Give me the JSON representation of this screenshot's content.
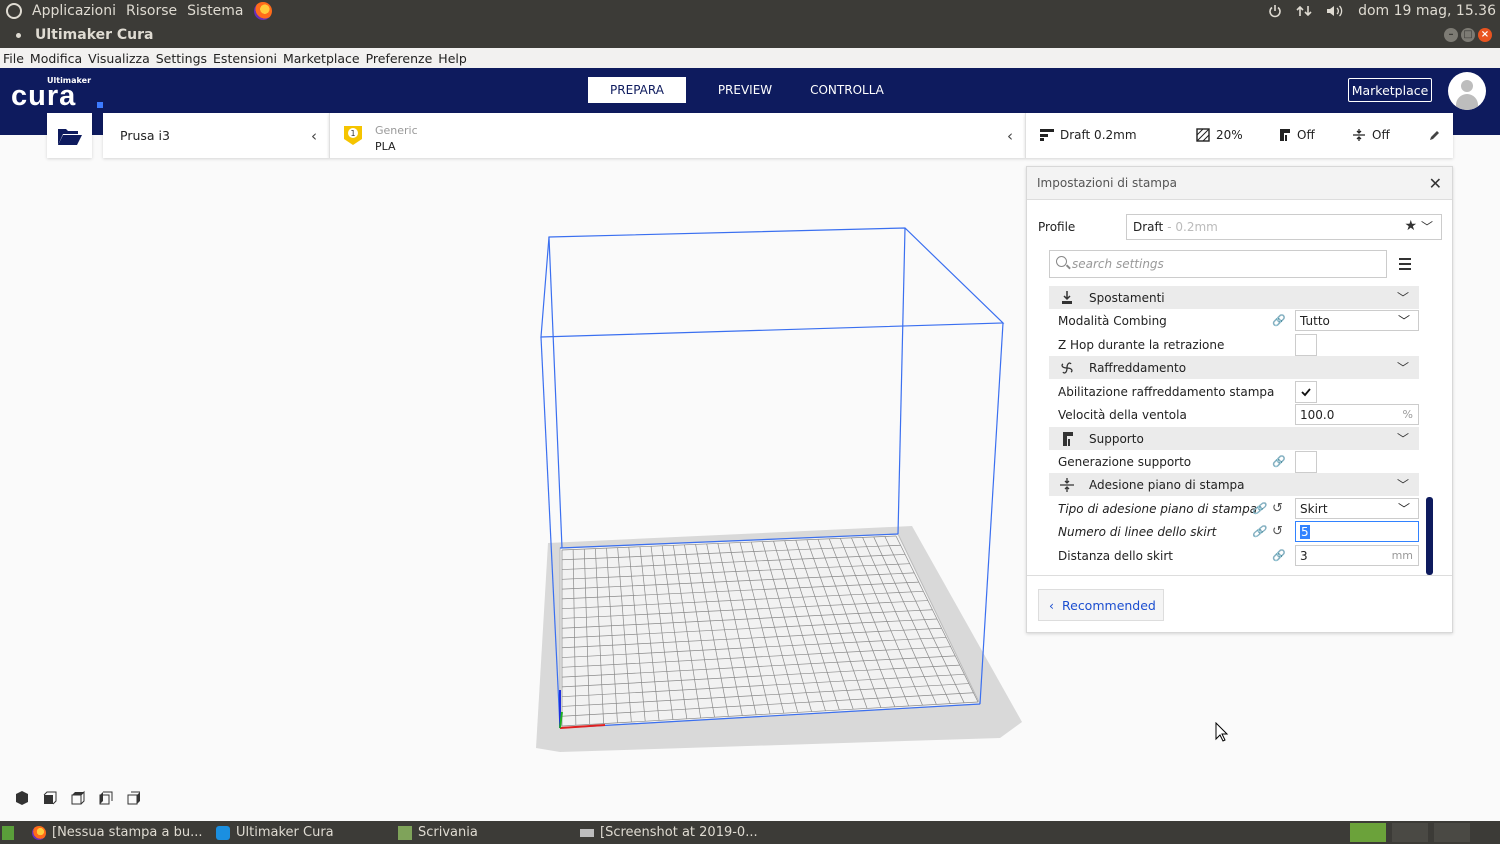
{
  "os_panel": {
    "applications": "Applicazioni",
    "places": "Risorse",
    "system": "Sistema",
    "datetime": "dom 19 mag, 15.36"
  },
  "window": {
    "title": "Ultimaker Cura"
  },
  "menu": [
    "File",
    "Modifica",
    "Visualizza",
    "Settings",
    "Estensioni",
    "Marketplace",
    "Preferenze",
    "Help"
  ],
  "header": {
    "logo_small": "Ultimaker",
    "logo_big": "cura",
    "tabs": [
      "PREPARA",
      "PREVIEW",
      "CONTROLLA"
    ],
    "marketplace": "Marketplace"
  },
  "toolbar": {
    "printer": "Prusa i3",
    "material_brand": "Generic",
    "material_name": "PLA",
    "material_badge": "1",
    "profile": "Draft 0.2mm",
    "infill": "20%",
    "support": "Off",
    "adhesion": "Off"
  },
  "settings": {
    "title": "Impostazioni di stampa",
    "profile_label": "Profile",
    "profile_name": "Draft",
    "profile_layer": " - 0.2mm",
    "search_placeholder": "search settings",
    "rows": {
      "travel": "Spostamenti",
      "combing": "Modalità Combing",
      "combing_value": "Tutto",
      "zhop": "Z Hop durante la retrazione",
      "cooling": "Raffreddamento",
      "enable_cooling": "Abilitazione raffreddamento stampa",
      "fan_speed": "Velocità della ventola",
      "fan_speed_value": "100.0",
      "fan_speed_unit": "%",
      "support": "Supporto",
      "gen_support": "Generazione supporto",
      "adhesion": "Adesione piano di stampa",
      "adhesion_type": "Tipo di adesione piano di stampa",
      "adhesion_type_value": "Skirt",
      "skirt_lines": "Numero di linee dello skirt",
      "skirt_lines_value": "5",
      "skirt_distance": "Distanza dello skirt",
      "skirt_distance_value": "3",
      "skirt_distance_unit": "mm"
    },
    "recommended": "Recommended"
  },
  "taskbar": {
    "items": [
      "[Nessua stampa a bu...",
      "Ultimaker Cura",
      "Scrivania",
      "[Screenshot at 2019-0..."
    ]
  },
  "colors": {
    "header": "#0e1b5e",
    "accent": "#3282ff",
    "os_panel": "#3c3b37"
  }
}
